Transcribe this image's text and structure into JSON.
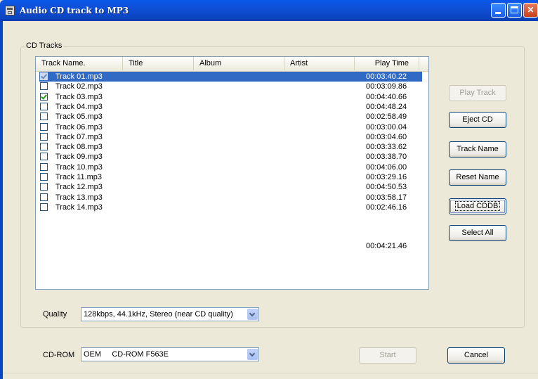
{
  "window": {
    "title": "Audio CD track to MP3"
  },
  "group": {
    "label": "CD Tracks"
  },
  "list": {
    "columns": [
      "Track Name.",
      "Title",
      "Album",
      "Artist",
      "Play Time"
    ],
    "rows": [
      {
        "name": "Track 01.mp3",
        "time": "00:03:40.22",
        "checked": true,
        "selected": true
      },
      {
        "name": "Track 02.mp3",
        "time": "00:03:09.86",
        "checked": false,
        "selected": false
      },
      {
        "name": "Track 03.mp3",
        "time": "00:04:40.66",
        "checked": true,
        "selected": false
      },
      {
        "name": "Track 04.mp3",
        "time": "00:04:48.24",
        "checked": false,
        "selected": false
      },
      {
        "name": "Track 05.mp3",
        "time": "00:02:58.49",
        "checked": false,
        "selected": false
      },
      {
        "name": "Track 06.mp3",
        "time": "00:03:00.04",
        "checked": false,
        "selected": false
      },
      {
        "name": "Track 07.mp3",
        "time": "00:03:04.60",
        "checked": false,
        "selected": false
      },
      {
        "name": "Track 08.mp3",
        "time": "00:03:33.62",
        "checked": false,
        "selected": false
      },
      {
        "name": "Track 09.mp3",
        "time": "00:03:38.70",
        "checked": false,
        "selected": false
      },
      {
        "name": "Track 10.mp3",
        "time": "00:04:06.00",
        "checked": false,
        "selected": false
      },
      {
        "name": "Track 11.mp3",
        "time": "00:03:29.16",
        "checked": false,
        "selected": false
      },
      {
        "name": "Track 12.mp3",
        "time": "00:04:50.53",
        "checked": false,
        "selected": false
      },
      {
        "name": "Track 13.mp3",
        "time": "00:03:58.17",
        "checked": false,
        "selected": false
      },
      {
        "name": "Track 14.mp3",
        "time": "00:02:46.16",
        "checked": false,
        "selected": false
      }
    ],
    "extra_time": "00:04:21.46"
  },
  "buttons": {
    "play_track": "Play Track",
    "eject_cd": "Eject CD",
    "track_name": "Track Name",
    "reset_name": "Reset Name",
    "load_cddb": "Load CDDB",
    "select_all": "Select All",
    "start": "Start",
    "cancel": "Cancel"
  },
  "quality": {
    "label": "Quality",
    "value": "128kbps, 44.1kHz, Stereo (near CD quality)"
  },
  "cdrom": {
    "label": "CD-ROM",
    "value": "OEM     CD-ROM F563E"
  },
  "colors": {
    "titlebar": "#0b46c3",
    "selection": "#316ac5",
    "face": "#ece9d8",
    "check": "#21a121"
  }
}
